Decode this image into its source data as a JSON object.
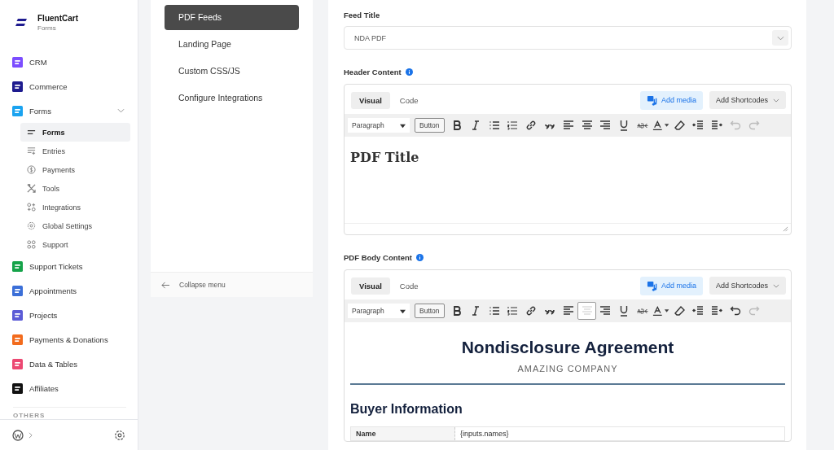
{
  "brand": {
    "name": "FluentCart",
    "subtitle": "Forms"
  },
  "nav": [
    {
      "label": "CRM",
      "color": "#7c4dff",
      "expanded": false
    },
    {
      "label": "Commerce",
      "color": "#1e1b8f",
      "expanded": false
    },
    {
      "label": "Forms",
      "color": "#1aa3f0",
      "expanded": true,
      "children": [
        {
          "kind": "lines",
          "label": "Forms",
          "selected": true
        },
        {
          "kind": "entries",
          "label": "Entries",
          "selected": false
        },
        {
          "kind": "coin",
          "label": "Payments",
          "selected": false
        },
        {
          "kind": "tools",
          "label": "Tools",
          "selected": false
        },
        {
          "kind": "nodes",
          "label": "Integrations",
          "selected": false
        },
        {
          "kind": "gear",
          "label": "Global Settings",
          "selected": false
        },
        {
          "kind": "grid",
          "label": "Support",
          "selected": false
        }
      ]
    },
    {
      "label": "Support Tickets",
      "color": "#16a34a",
      "expanded": false
    },
    {
      "label": "Appointments",
      "color": "#3b6fd8",
      "expanded": false
    },
    {
      "label": "Projects",
      "color": "#5b5bd6",
      "expanded": false
    },
    {
      "label": "Payments & Donations",
      "color": "#f26b1d",
      "expanded": false
    },
    {
      "label": "Data & Tables",
      "color": "#ec4872",
      "expanded": false
    },
    {
      "label": "Affiliates",
      "color": "#111111",
      "expanded": false
    }
  ],
  "others_heading": "OTHERS",
  "submenu": [
    {
      "label": "PDF Feeds",
      "selected": true
    },
    {
      "label": "Landing Page",
      "selected": false
    },
    {
      "label": "Custom CSS/JS",
      "selected": false
    },
    {
      "label": "Configure Integrations",
      "selected": false
    }
  ],
  "collapse": "Collapse menu",
  "feed_title": {
    "label": "Feed Title",
    "value": "NDA PDF"
  },
  "editors": [
    {
      "label": "Header Content",
      "tabs": [
        {
          "label": "Visual",
          "selected": true
        },
        {
          "label": "Code",
          "selected": false
        }
      ],
      "add_media": "Add media",
      "shortcodes": "Add Shortcodes",
      "format": "Paragraph",
      "insert_button": "Button",
      "tools": [
        {
          "kind": "bold",
          "pressed": false,
          "disabled": false
        },
        {
          "kind": "italic",
          "pressed": false,
          "disabled": false
        },
        {
          "kind": "bullets",
          "pressed": false,
          "disabled": false
        },
        {
          "kind": "numbers",
          "pressed": false,
          "disabled": false
        },
        {
          "kind": "link",
          "pressed": false,
          "disabled": false
        },
        {
          "kind": "quote",
          "pressed": false,
          "disabled": false
        },
        {
          "kind": "align-left",
          "pressed": false,
          "disabled": false
        },
        {
          "kind": "align-center",
          "pressed": false,
          "disabled": false
        },
        {
          "kind": "align-right",
          "pressed": false,
          "disabled": false
        },
        {
          "kind": "underline",
          "pressed": false,
          "disabled": false
        },
        {
          "kind": "strike",
          "pressed": false,
          "disabled": false
        },
        {
          "kind": "text-color",
          "pressed": false,
          "disabled": false
        },
        {
          "kind": "eraser",
          "pressed": false,
          "disabled": false
        },
        {
          "kind": "outdent",
          "pressed": false,
          "disabled": false
        },
        {
          "kind": "indent",
          "pressed": false,
          "disabled": false
        },
        {
          "kind": "undo",
          "pressed": false,
          "disabled": true
        },
        {
          "kind": "redo",
          "pressed": false,
          "disabled": true
        }
      ],
      "content": [
        {
          "kind": "serif-heading",
          "text": "PDF Title"
        }
      ]
    },
    {
      "label": "PDF Body Content",
      "tabs": [
        {
          "label": "Visual",
          "selected": true
        },
        {
          "label": "Code",
          "selected": false
        }
      ],
      "add_media": "Add media",
      "shortcodes": "Add Shortcodes",
      "format": "Paragraph",
      "insert_button": "Button",
      "tools": [
        {
          "kind": "bold",
          "pressed": false,
          "disabled": false
        },
        {
          "kind": "italic",
          "pressed": false,
          "disabled": false
        },
        {
          "kind": "bullets",
          "pressed": false,
          "disabled": false
        },
        {
          "kind": "numbers",
          "pressed": false,
          "disabled": false
        },
        {
          "kind": "link",
          "pressed": false,
          "disabled": false
        },
        {
          "kind": "quote",
          "pressed": false,
          "disabled": false
        },
        {
          "kind": "align-left",
          "pressed": false,
          "disabled": false
        },
        {
          "kind": "align-center",
          "pressed": true,
          "disabled": false
        },
        {
          "kind": "align-right",
          "pressed": false,
          "disabled": false
        },
        {
          "kind": "underline",
          "pressed": false,
          "disabled": false
        },
        {
          "kind": "strike",
          "pressed": false,
          "disabled": false
        },
        {
          "kind": "text-color",
          "pressed": false,
          "disabled": false
        },
        {
          "kind": "eraser",
          "pressed": false,
          "disabled": false
        },
        {
          "kind": "outdent",
          "pressed": false,
          "disabled": false
        },
        {
          "kind": "indent",
          "pressed": false,
          "disabled": false
        },
        {
          "kind": "undo",
          "pressed": false,
          "disabled": false
        },
        {
          "kind": "redo",
          "pressed": false,
          "disabled": true
        }
      ],
      "content": [
        {
          "kind": "title",
          "text": "Nondisclosure Agreement"
        },
        {
          "kind": "subtitle",
          "text": "AMAZING COMPANY"
        },
        {
          "kind": "rule"
        },
        {
          "kind": "heading",
          "text": "Buyer Information"
        },
        {
          "kind": "table-row",
          "cells": [
            "Name",
            "{inputs.names}"
          ]
        }
      ]
    }
  ]
}
